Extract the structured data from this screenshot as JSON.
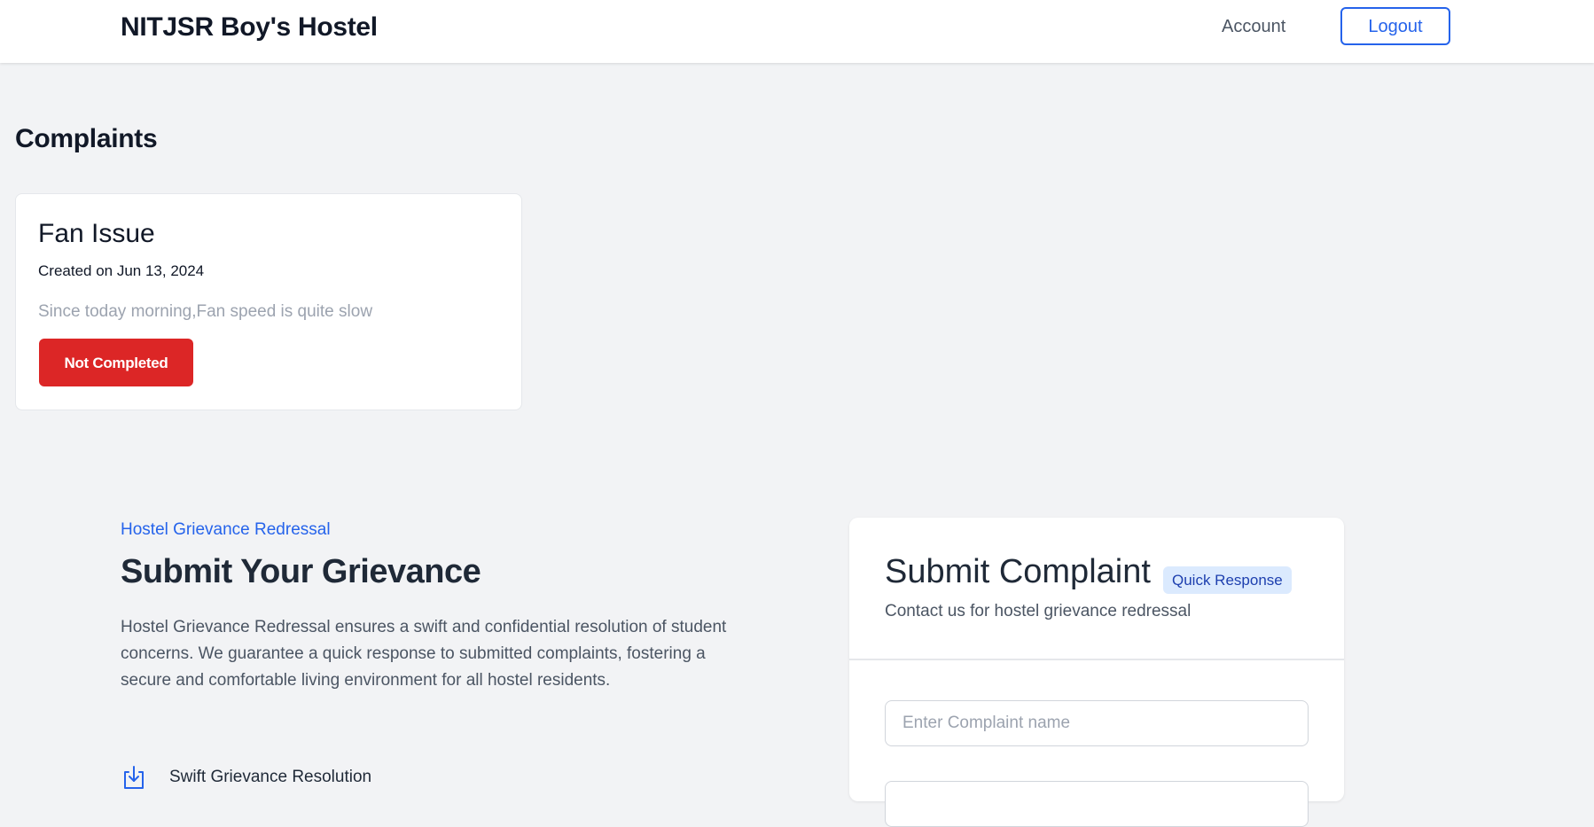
{
  "navbar": {
    "brand": "NITJSR Boy's Hostel",
    "account_label": "Account",
    "logout_label": "Logout"
  },
  "complaints": {
    "title": "Complaints",
    "items": [
      {
        "title": "Fan Issue",
        "created": "Created on Jun 13, 2024",
        "description": "Since today morning,Fan speed is quite slow",
        "status": "Not Completed"
      }
    ]
  },
  "grievance": {
    "kicker": "Hostel Grievance Redressal",
    "headline": "Submit Your Grievance",
    "description": "Hostel Grievance Redressal ensures a swift and confidential resolution of student concerns. We guarantee a quick response to submitted complaints, fostering a secure and comfortable living environment for all hostel residents.",
    "features": [
      {
        "icon": "download-arrow-icon",
        "label": "Swift Grievance Resolution"
      }
    ]
  },
  "form": {
    "title": "Submit Complaint",
    "badge": "Quick Response",
    "subtitle": "Contact us for hostel grievance redressal",
    "name_placeholder": "Enter Complaint name",
    "name_value": ""
  },
  "colors": {
    "accent": "#2563eb",
    "danger": "#dc2626",
    "background": "#f2f3f5"
  }
}
